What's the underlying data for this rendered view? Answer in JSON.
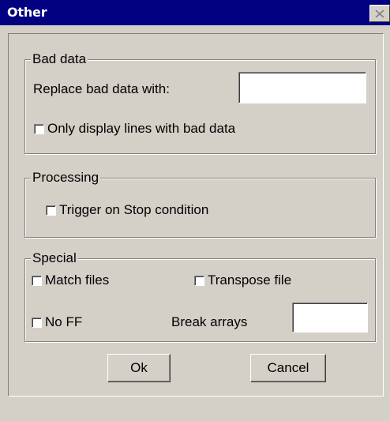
{
  "window": {
    "title": "Other",
    "close_icon": "close-icon"
  },
  "bad_data": {
    "legend": "Bad data",
    "replace_label": "Replace bad data with:",
    "replace_value": "",
    "only_display_label": "Only display lines with bad data",
    "only_display_checked": false
  },
  "processing": {
    "legend": "Processing",
    "trigger_label": "Trigger on Stop condition",
    "trigger_checked": false
  },
  "special": {
    "legend": "Special",
    "match_files_label": "Match files",
    "match_files_checked": false,
    "transpose_label": "Transpose file",
    "transpose_checked": false,
    "no_ff_label": "No FF",
    "no_ff_checked": false,
    "break_arrays_label": "Break arrays",
    "break_arrays_value": ""
  },
  "buttons": {
    "ok": "Ok",
    "cancel": "Cancel"
  },
  "colors": {
    "titlebar": "#000080",
    "face": "#d4d0c8"
  }
}
